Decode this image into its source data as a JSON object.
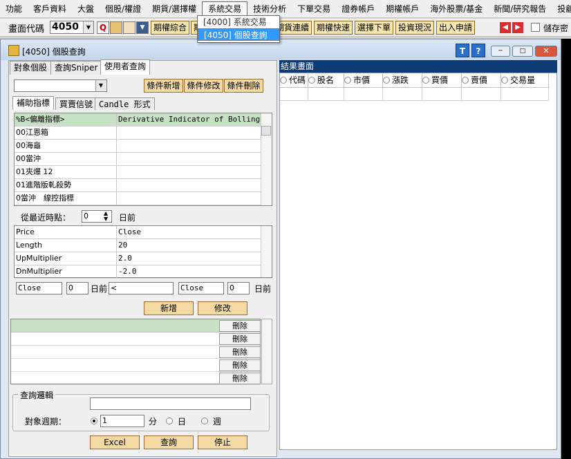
{
  "menu": [
    "功能",
    "客戶資料",
    "大盤",
    "個股/權證",
    "期貨/選擇權",
    "系統交易",
    "技術分析",
    "下單交易",
    "證券帳戶",
    "期權帳戶",
    "海外股票/基金",
    "新聞/研究報告",
    "投顧專區"
  ],
  "dropdown": {
    "items": [
      "[4000] 系統交易",
      "[4050] 個股查詢"
    ]
  },
  "toolbar": {
    "code_label": "畫面代碼",
    "code_value": "4050",
    "buttons": [
      "期權綜合",
      "期",
      "期貨連續",
      "期權快速",
      "選擇下單",
      "投資現況",
      "出入申請"
    ],
    "save_label": "儲存密"
  },
  "window": {
    "title": "[4050] 個股查詢",
    "help_t": "T",
    "help_q": "?"
  },
  "tabs": [
    "對象個股",
    "查詢Sniper",
    "使用者查詢"
  ],
  "cond_buttons": [
    "條件新增",
    "條件修改",
    "條件刪除"
  ],
  "subtabs": [
    "補助指標",
    "買賣信號",
    "Candle 形式"
  ],
  "indicators": [
    {
      "name": "%B<偏離指標>",
      "desc": "Derivative Indicator of Bollinger'"
    },
    {
      "name": "00江恩箱",
      "desc": ""
    },
    {
      "name": "00海龜",
      "desc": ""
    },
    {
      "name": "00當沖",
      "desc": ""
    },
    {
      "name": "01夾爆 12",
      "desc": ""
    },
    {
      "name": "01進階版軋殺勢",
      "desc": ""
    },
    {
      "name": "0當沖　線控指標",
      "desc": ""
    }
  ],
  "recent": {
    "label": "從最近時點：",
    "value": "0",
    "suffix": "日前"
  },
  "params": [
    {
      "name": "Price",
      "value": "Close"
    },
    {
      "name": "Length",
      "value": "20"
    },
    {
      "name": "UpMultiplier",
      "value": "2.0"
    },
    {
      "name": "DnMultiplier",
      "value": "-2.0"
    }
  ],
  "compare": {
    "left": "Close",
    "left_n": "0",
    "days1": "日前",
    "op": "<",
    "right": "Close",
    "right_n": "0",
    "days2": "日前"
  },
  "add_edit": [
    "新增",
    "修改"
  ],
  "delete_label": "刪除",
  "logic": {
    "legend": "查詢邏輯",
    "period_label": "對象週期：",
    "period_value": "1",
    "unit_min": "分",
    "unit_day": "日",
    "unit_week": "週"
  },
  "bottom_buttons": [
    "Excel",
    "查詢",
    "停止"
  ],
  "result": {
    "title": "結果畫面",
    "columns": [
      "代碼",
      "股名",
      "市價",
      "漲跌",
      "買價",
      "賣價",
      "交易量"
    ]
  }
}
